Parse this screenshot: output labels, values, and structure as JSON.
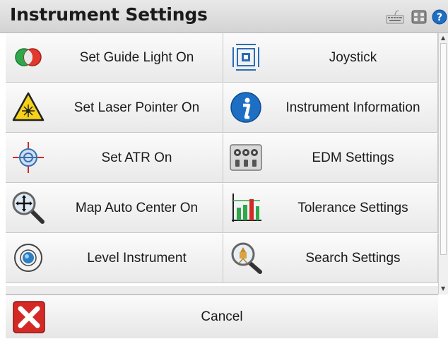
{
  "window": {
    "title": "Instrument Settings"
  },
  "toolbar_icons": [
    "keyboard-icon",
    "controller-icon",
    "help-icon"
  ],
  "items": [
    {
      "label": "Set Guide Light On",
      "icon": "guide-light-icon"
    },
    {
      "label": "Joystick",
      "icon": "joystick-icon"
    },
    {
      "label": "Set Laser Pointer On",
      "icon": "laser-warning-icon"
    },
    {
      "label": "Instrument Information",
      "icon": "info-icon"
    },
    {
      "label": "Set ATR On",
      "icon": "atr-crosshair-icon"
    },
    {
      "label": "EDM Settings",
      "icon": "edm-dials-icon"
    },
    {
      "label": "Map Auto Center On",
      "icon": "map-center-magnifier-icon"
    },
    {
      "label": "Tolerance Settings",
      "icon": "tolerance-chart-icon"
    },
    {
      "label": "Level Instrument",
      "icon": "level-bubble-icon"
    },
    {
      "label": "Search Settings",
      "icon": "search-prism-icon"
    }
  ],
  "footer": {
    "cancel_label": "Cancel"
  },
  "colors": {
    "cancel_red": "#d42a25",
    "info_blue": "#1e6fc4",
    "accent_green": "#2ea84a"
  }
}
